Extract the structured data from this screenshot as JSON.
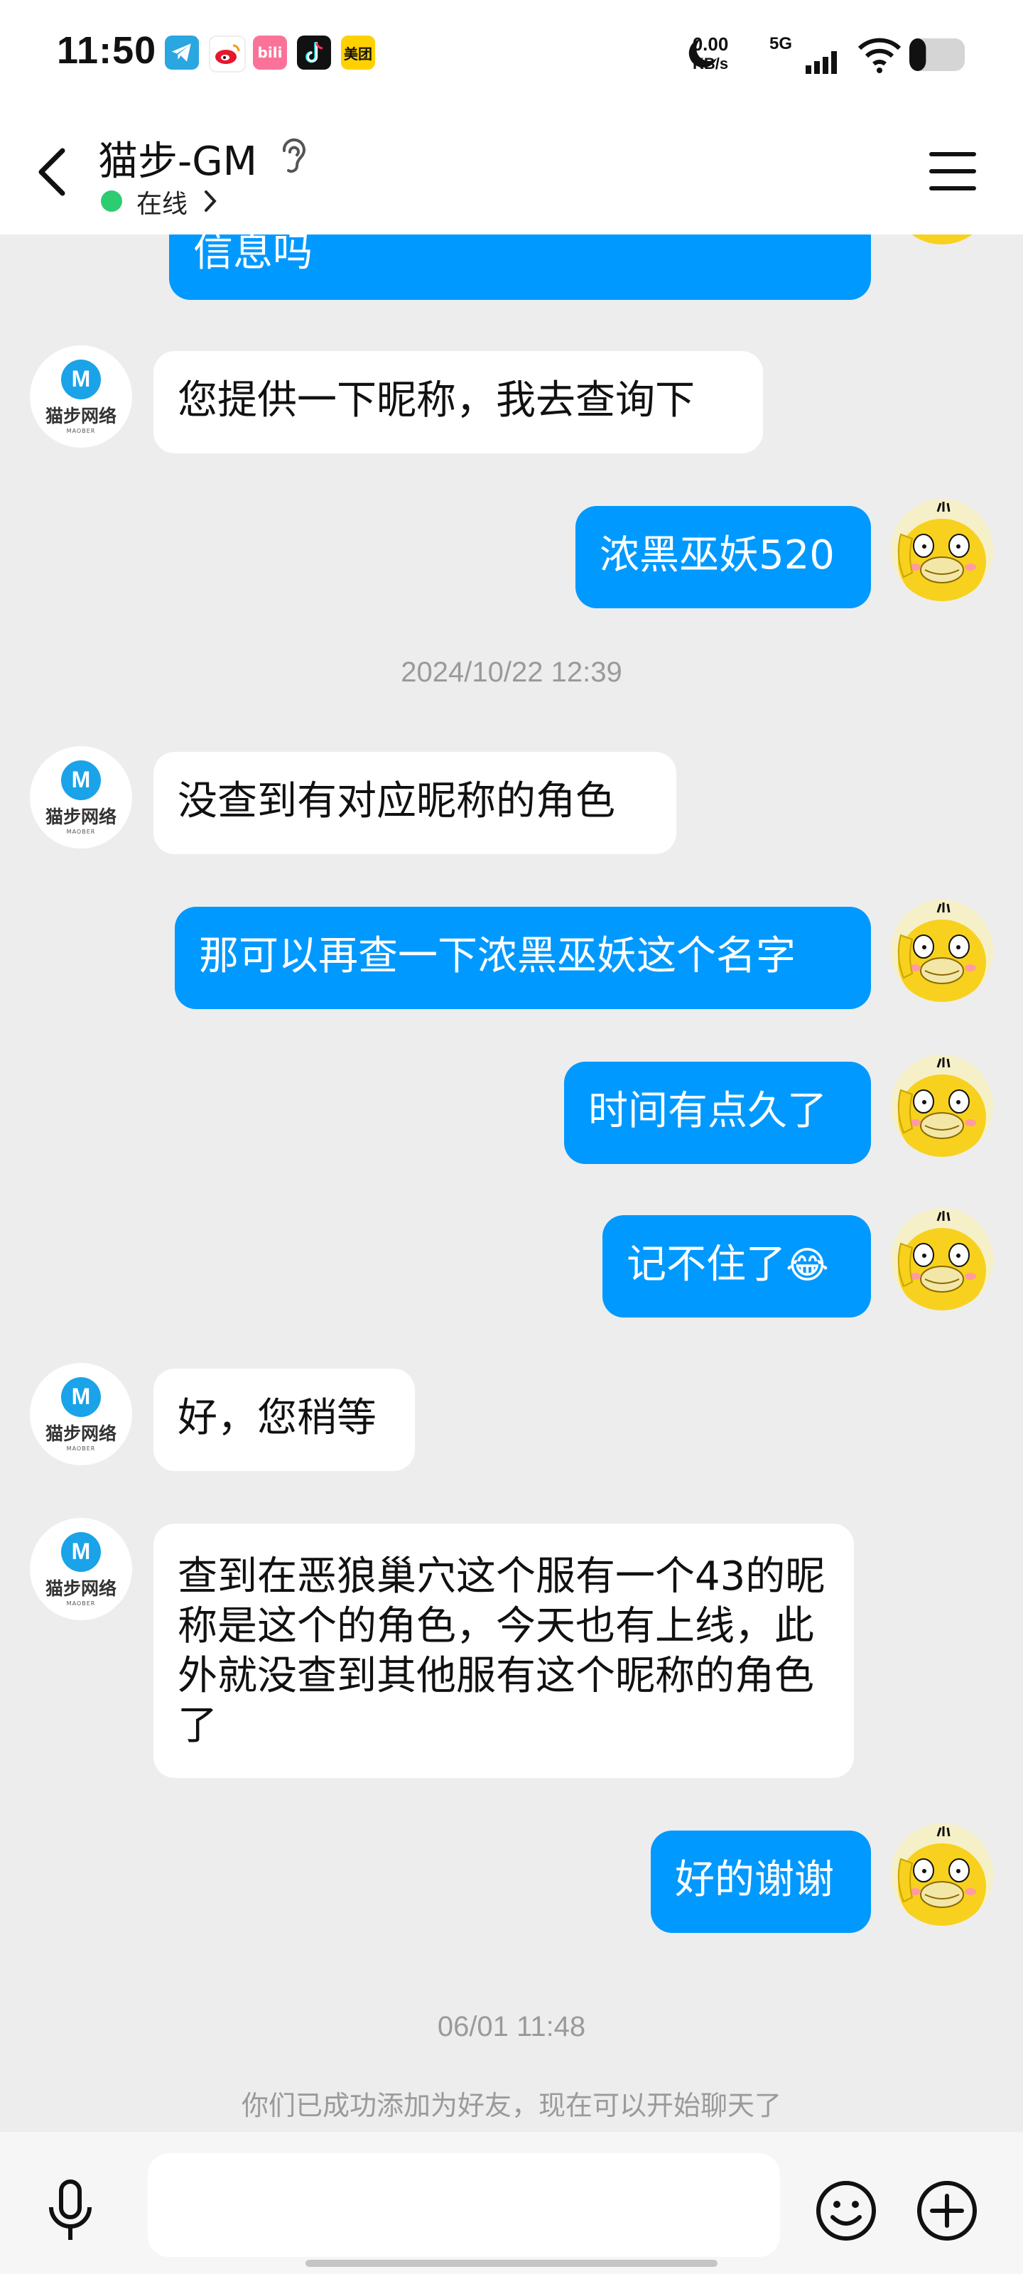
{
  "status_bar": {
    "time": "11:50",
    "app_icons": [
      "telegram-icon",
      "weibo-icon",
      "bilibili-icon",
      "tiktok-icon",
      "meituan-icon"
    ],
    "bilibili_label": "bili",
    "meituan_label": "美团",
    "net_speed_value": "0.00",
    "net_speed_unit": "KB/s",
    "network": "5G",
    "battery_level": 0.3
  },
  "header": {
    "title": "猫步-GM",
    "status": "在线",
    "status_color": "#2ecc71"
  },
  "gm_avatar": {
    "brand": "猫步网络",
    "sub": "MAOBER",
    "mark": "M"
  },
  "messages": {
    "m0": "信息吗",
    "m1": "您提供一下昵称，我去查询下",
    "m2": "浓黑巫妖520",
    "ts1": "2024/10/22 12:39",
    "m3": "没查到有对应昵称的角色",
    "m4": "那可以再查一下浓黑巫妖这个名字",
    "m5": "时间有点久了",
    "m6": "记不住了",
    "m6_emoji": "😂",
    "m7": "好，您稍等",
    "m8": "查到在恶狼巢穴这个服有一个43的昵称是这个的角色，今天也有上线，此外就没查到其他服有这个昵称的角色了",
    "m9": "好的谢谢",
    "ts2": "06/01 11:48",
    "system": "你们已成功添加为好友，现在可以开始聊天了"
  },
  "input": {
    "placeholder": ""
  },
  "colors": {
    "outgoing": "#0099ff",
    "incoming": "#ffffff",
    "background": "#ededed"
  }
}
